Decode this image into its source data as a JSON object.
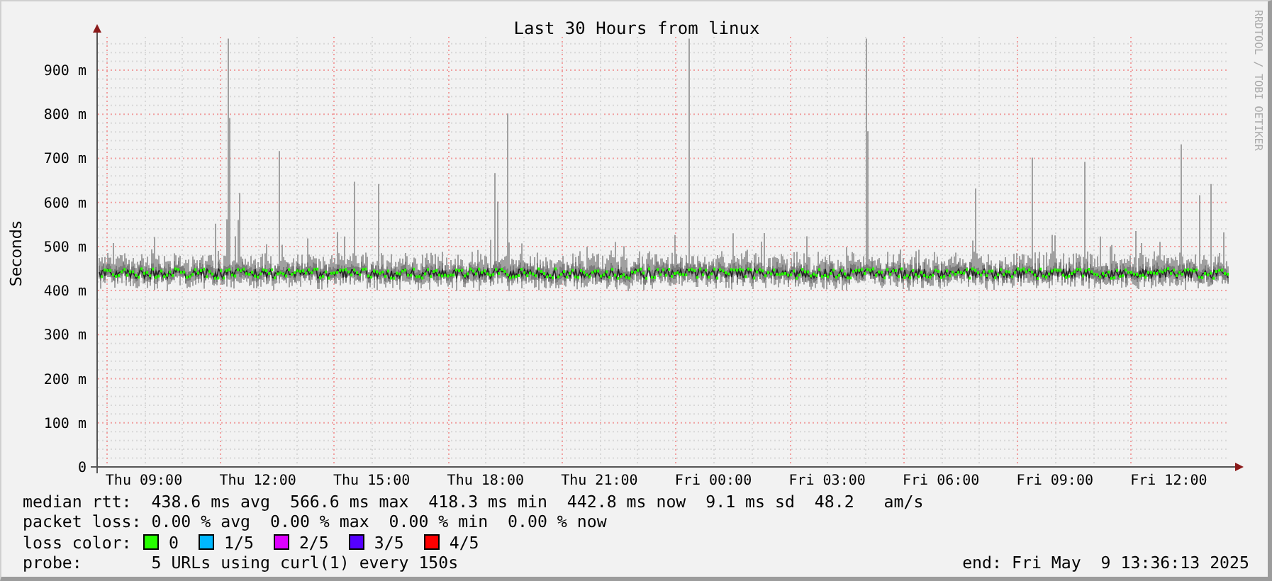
{
  "chart": {
    "title": "Last 30 Hours from linux",
    "ylabel": "Seconds",
    "credit": "RRDTOOL / TOBI OETIKER",
    "yticks": [
      "900 m",
      "800 m",
      "700 m",
      "600 m",
      "500 m",
      "400 m",
      "300 m",
      "200 m",
      "100 m",
      "0"
    ],
    "xticks": [
      "Thu 09:00",
      "Thu 12:00",
      "Thu 15:00",
      "Thu 18:00",
      "Thu 21:00",
      "Fri 00:00",
      "Fri 03:00",
      "Fri 06:00",
      "Fri 09:00",
      "Fri 12:00"
    ]
  },
  "legend": {
    "median_rtt": "median rtt:  438.6 ms avg  566.6 ms max  418.3 ms min  442.8 ms now  9.1 ms sd  48.2   am/s",
    "packet_loss": "packet loss: 0.00 % avg  0.00 % max  0.00 % min  0.00 % now",
    "loss_color_label": "loss color:",
    "loss_colors": [
      {
        "label": "0",
        "color": "#26ff00"
      },
      {
        "label": "1/5",
        "color": "#00b8ff"
      },
      {
        "label": "2/5",
        "color": "#dd00ff"
      },
      {
        "label": "3/5",
        "color": "#5500ff"
      },
      {
        "label": "4/5",
        "color": "#ff0000"
      }
    ],
    "probe": "probe:       5 URLs using curl(1) every 150s",
    "end": "end: Fri May  9 13:36:13 2025"
  }
}
